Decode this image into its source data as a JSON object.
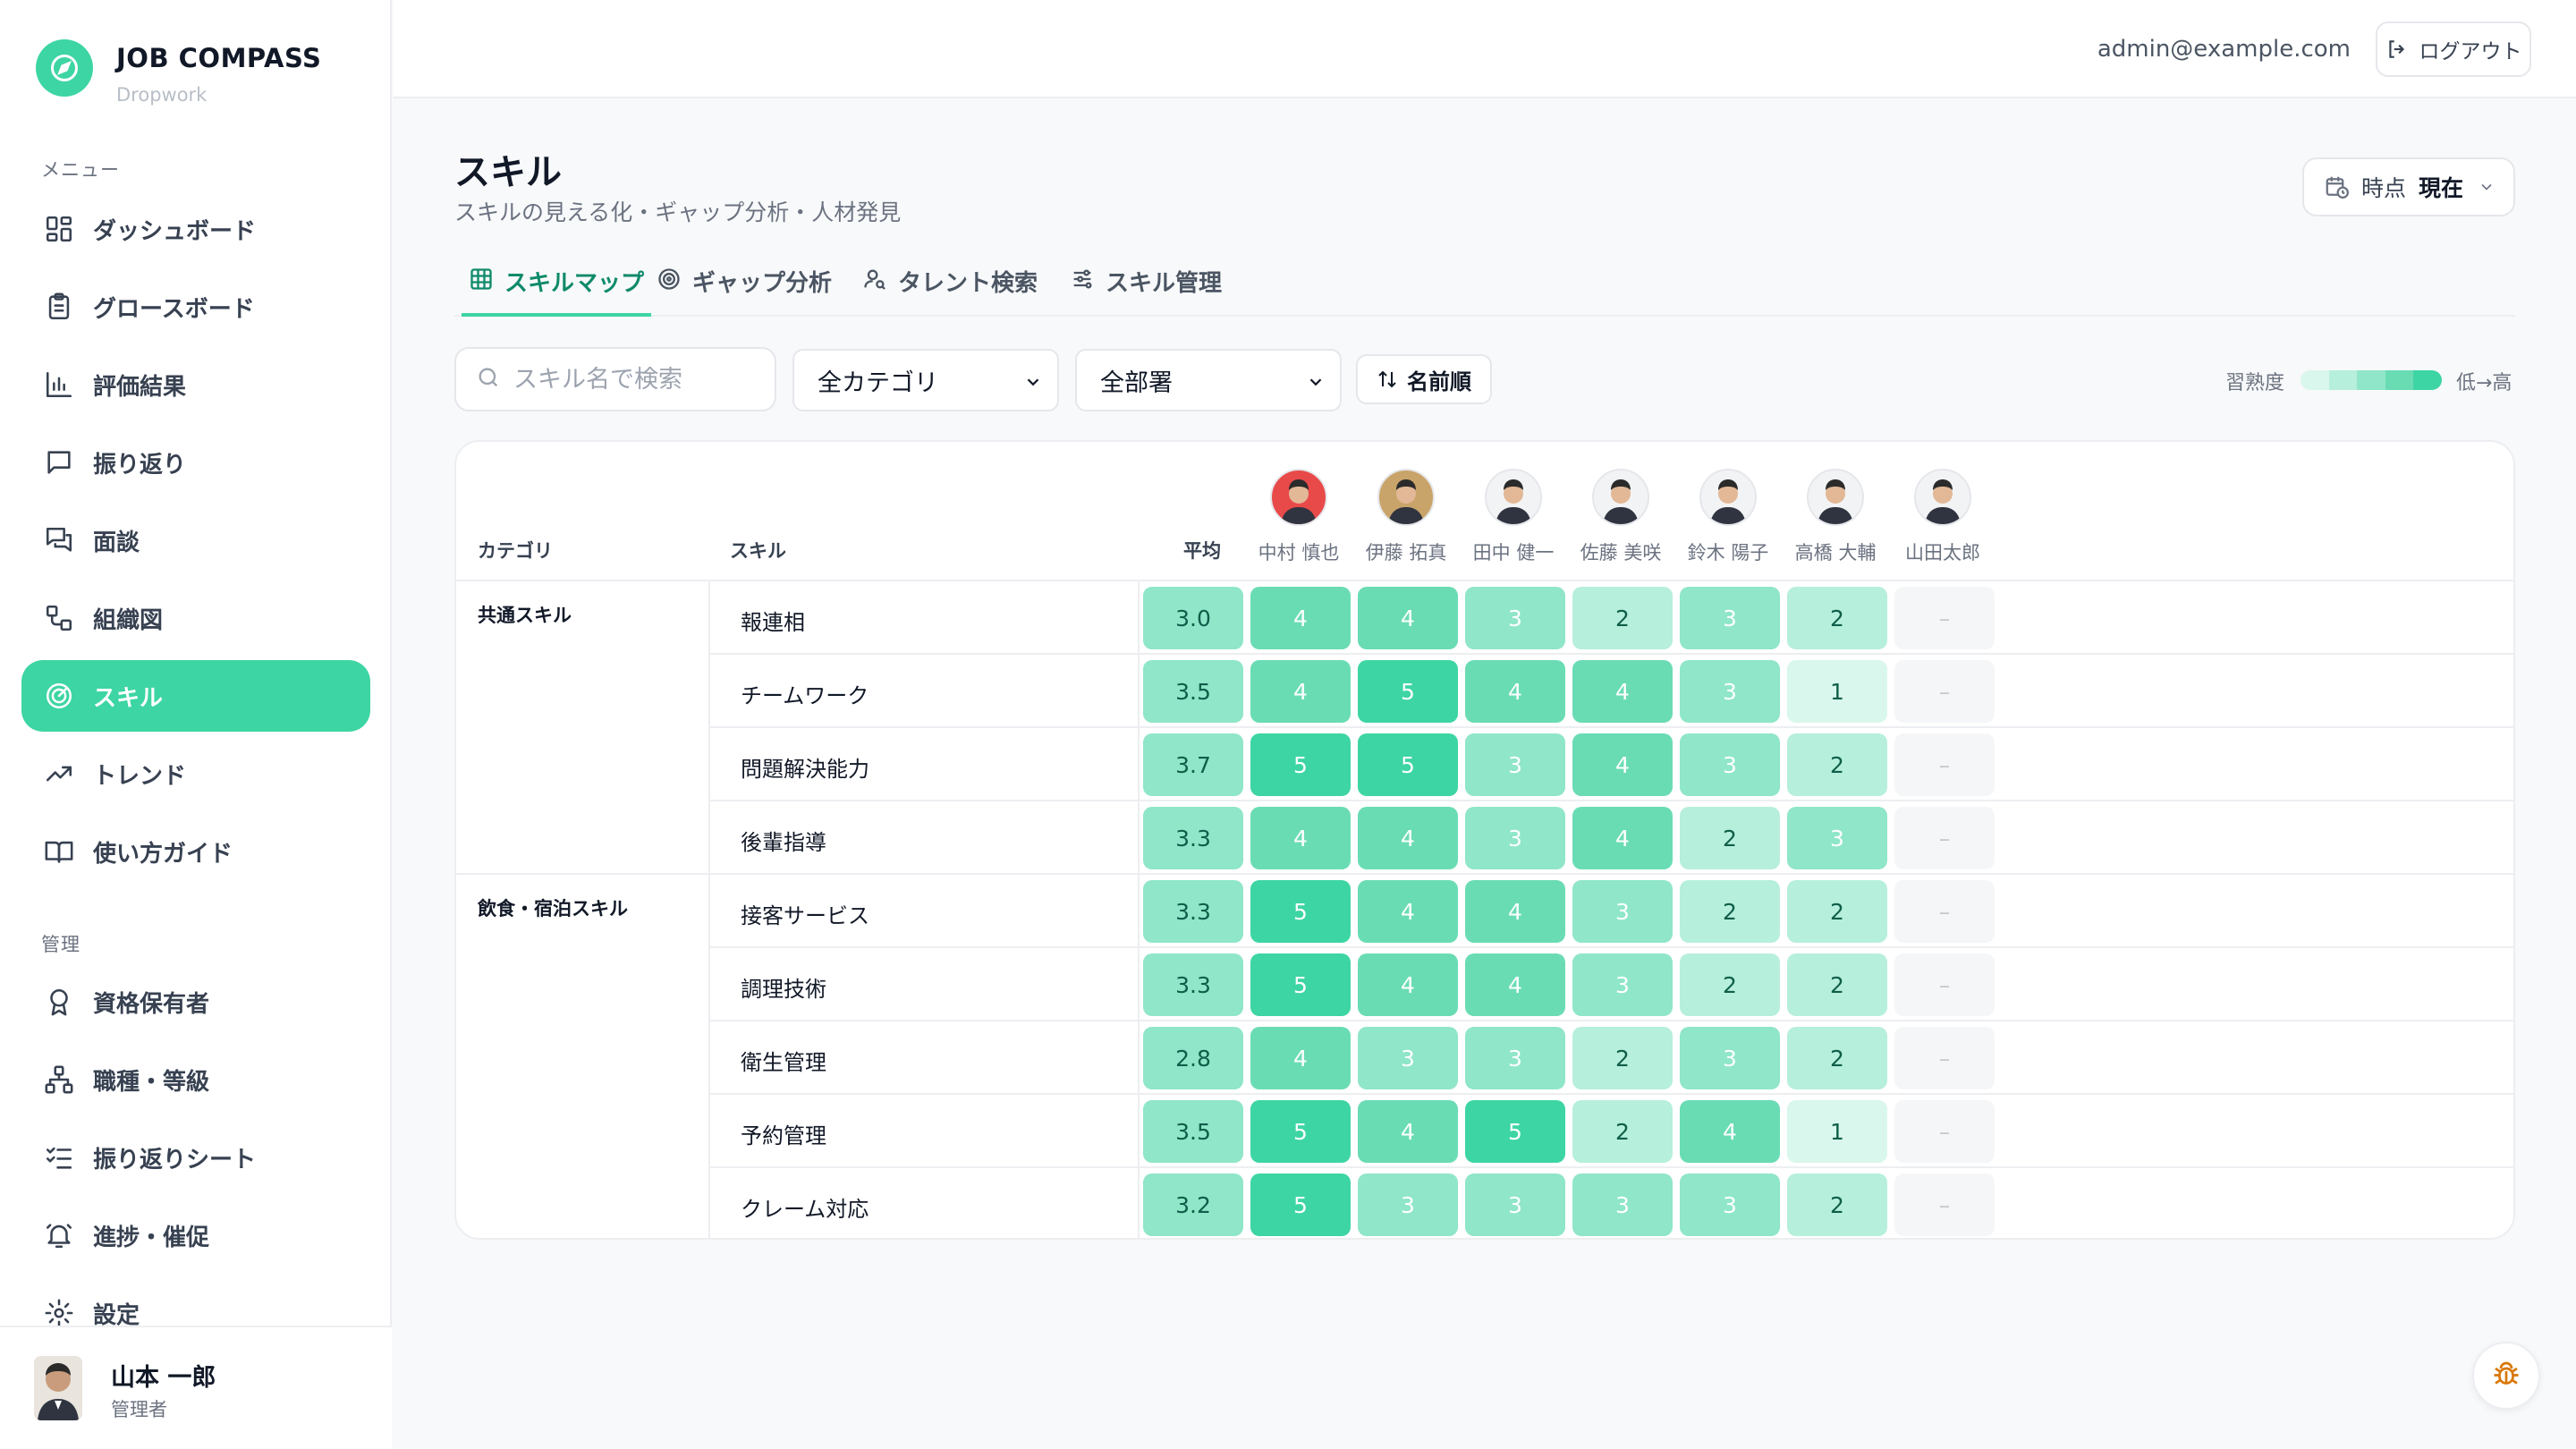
{
  "app": {
    "title": "JOB COMPASS",
    "subtitle": "Dropwork"
  },
  "colors": {
    "accent": "#3dd5a3",
    "accent_dark": "#0f8a6a",
    "empty": "#f5f6f7",
    "empty_text": "#c4c9cf"
  },
  "sidebar": {
    "menu_label": "メニュー",
    "admin_label": "管理",
    "items": [
      {
        "label": "ダッシュボード",
        "icon": "dashboard-icon"
      },
      {
        "label": "グロースボード",
        "icon": "clipboard-icon"
      },
      {
        "label": "評価結果",
        "icon": "bar-chart-icon"
      },
      {
        "label": "振り返り",
        "icon": "chat-icon"
      },
      {
        "label": "面談",
        "icon": "chats-icon"
      },
      {
        "label": "組織図",
        "icon": "org-icon"
      },
      {
        "label": "スキル",
        "icon": "radar-icon",
        "active": true
      },
      {
        "label": "トレンド",
        "icon": "trend-icon"
      },
      {
        "label": "使い方ガイド",
        "icon": "book-icon"
      }
    ],
    "admin_items": [
      {
        "label": "資格保有者",
        "icon": "award-icon"
      },
      {
        "label": "職種・等級",
        "icon": "hierarchy-icon"
      },
      {
        "label": "振り返りシート",
        "icon": "checklist-icon"
      },
      {
        "label": "進捗・催促",
        "icon": "bell-icon"
      },
      {
        "label": "設定",
        "icon": "gear-icon"
      }
    ]
  },
  "user": {
    "name": "山本 一郎",
    "role": "管理者"
  },
  "header": {
    "email": "admin@example.com",
    "logout": "ログアウト"
  },
  "page": {
    "title": "スキル",
    "subtitle": "スキルの見える化・ギャップ分析・人材発見",
    "time_label": "時点",
    "time_value": "現在"
  },
  "tabs": [
    {
      "label": "スキルマップ",
      "icon": "grid-icon",
      "active": true
    },
    {
      "label": "ギャップ分析",
      "icon": "target-icon"
    },
    {
      "label": "タレント検索",
      "icon": "user-search-icon"
    },
    {
      "label": "スキル管理",
      "icon": "sliders-icon"
    }
  ],
  "filters": {
    "search_placeholder": "スキル名で検索",
    "category": "全カテゴリ",
    "department": "全部署",
    "sort": "名前順",
    "legend_label": "習熟度",
    "legend_range": "低→高",
    "legend_colors": [
      "#d9f7ec",
      "#b6efdb",
      "#8fe6c8",
      "#6adcb4",
      "#3dd5a3"
    ]
  },
  "table": {
    "headers": {
      "category": "カテゴリ",
      "skill": "スキル",
      "average": "平均"
    },
    "people": [
      {
        "name": "中村 慎也",
        "avatar_bg": "#e84a4a"
      },
      {
        "name": "伊藤 拓真",
        "avatar_bg": "#c9a46a"
      },
      {
        "name": "田中 健一",
        "avatar_bg": "#f2f3f4"
      },
      {
        "name": "佐藤 美咲",
        "avatar_bg": "#f2f3f4"
      },
      {
        "name": "鈴木 陽子",
        "avatar_bg": "#f2f3f4"
      },
      {
        "name": "高橋 大輔",
        "avatar_bg": "#f2f3f4"
      },
      {
        "name": "山田太郎",
        "avatar_bg": "#f2f3f4"
      }
    ],
    "empty_mark": "–",
    "groups": [
      {
        "category": "共通スキル",
        "rows": [
          {
            "skill": "報連相",
            "avg": "3.0",
            "scores": [
              4,
              4,
              3,
              2,
              3,
              2,
              null
            ]
          },
          {
            "skill": "チームワーク",
            "avg": "3.5",
            "scores": [
              4,
              5,
              4,
              4,
              3,
              1,
              null
            ]
          },
          {
            "skill": "問題解決能力",
            "avg": "3.7",
            "scores": [
              5,
              5,
              3,
              4,
              3,
              2,
              null
            ]
          },
          {
            "skill": "後輩指導",
            "avg": "3.3",
            "scores": [
              4,
              4,
              3,
              4,
              2,
              3,
              null
            ]
          }
        ]
      },
      {
        "category": "飲食・宿泊スキル",
        "rows": [
          {
            "skill": "接客サービス",
            "avg": "3.3",
            "scores": [
              5,
              4,
              4,
              3,
              2,
              2,
              null
            ]
          },
          {
            "skill": "調理技術",
            "avg": "3.3",
            "scores": [
              5,
              4,
              4,
              3,
              2,
              2,
              null
            ]
          },
          {
            "skill": "衛生管理",
            "avg": "2.8",
            "scores": [
              4,
              3,
              3,
              2,
              3,
              2,
              null
            ]
          },
          {
            "skill": "予約管理",
            "avg": "3.5",
            "scores": [
              5,
              4,
              5,
              2,
              4,
              1,
              null
            ]
          },
          {
            "skill": "クレーム対応",
            "avg": "3.2",
            "scores": [
              5,
              3,
              3,
              3,
              3,
              2,
              null
            ]
          }
        ]
      }
    ]
  }
}
